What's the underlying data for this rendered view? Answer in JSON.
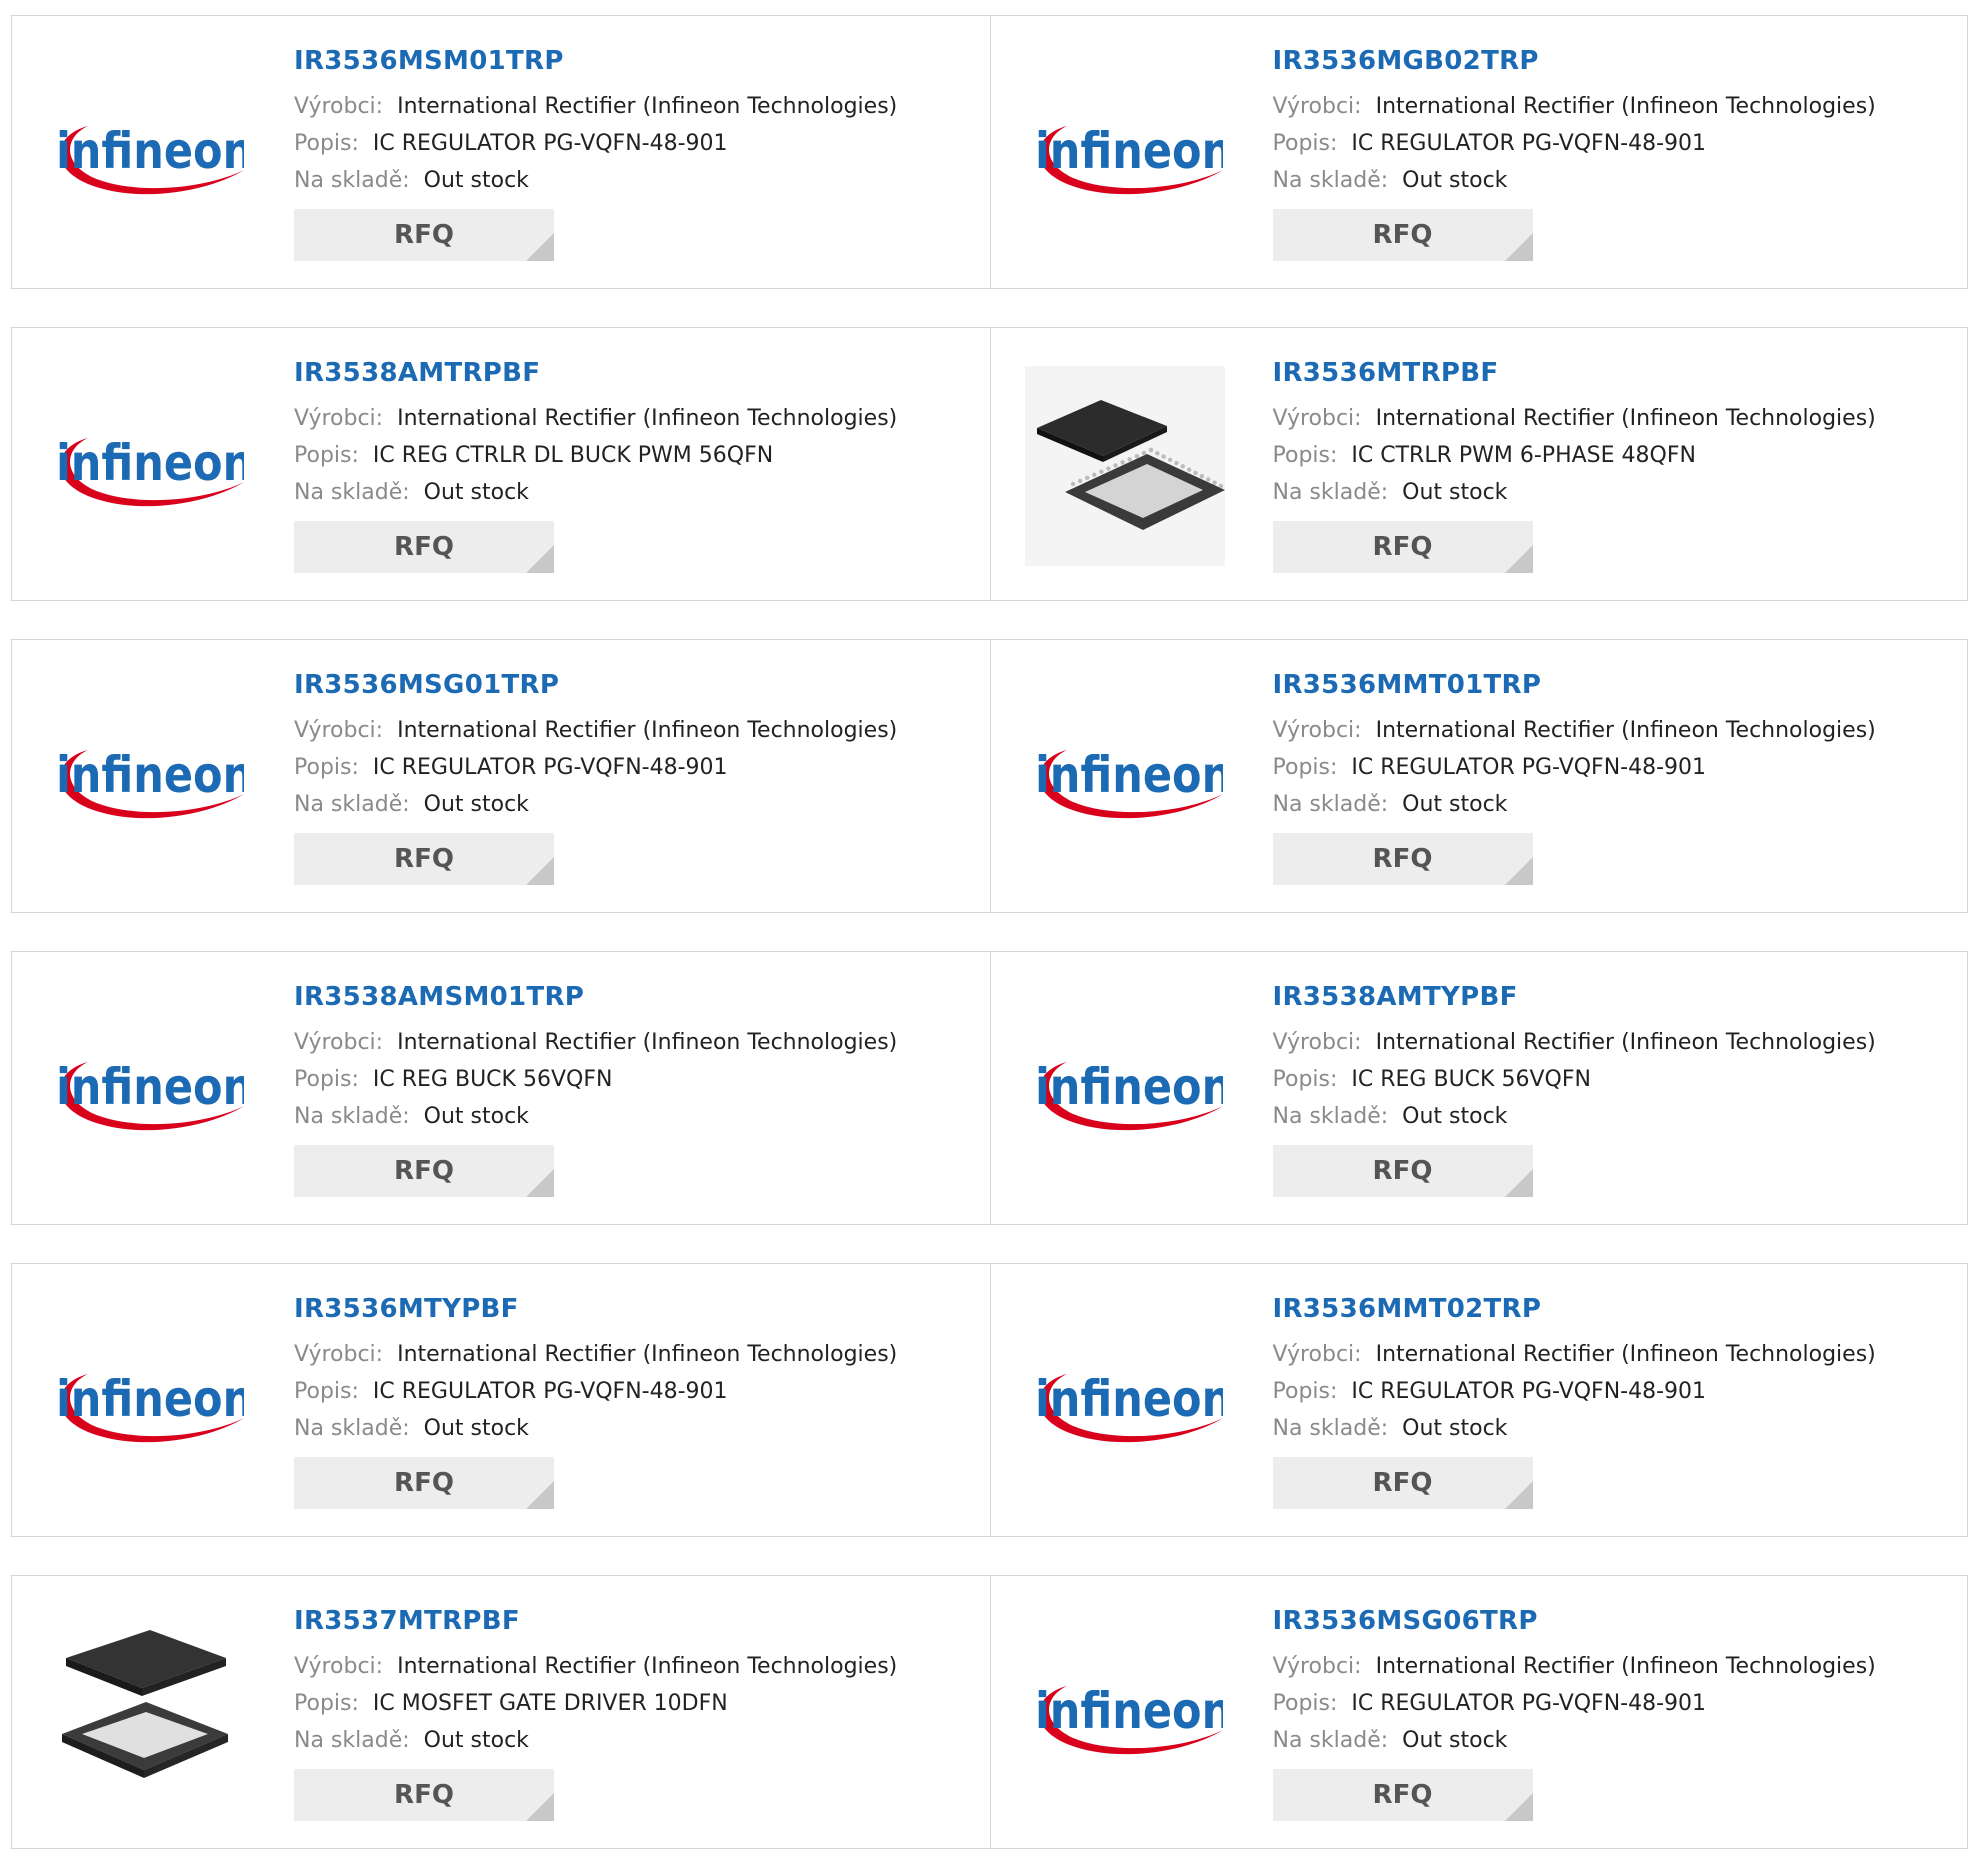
{
  "labels": {
    "manufacturer": "Výrobci:",
    "description": "Popis:",
    "stock": "Na skladě:",
    "rfq": "RFQ"
  },
  "brand": {
    "logo_text": "infineon",
    "accent": "#d9001b",
    "text_color": "#1b6ab3"
  },
  "products": [
    {
      "part": "IR3536MSM01TRP",
      "manufacturer": "International Rectifier (Infineon Technologies)",
      "description": "IC REGULATOR PG-VQFN-48-901",
      "stock": "Out stock",
      "image": "infineon-logo"
    },
    {
      "part": "IR3536MGB02TRP",
      "manufacturer": "International Rectifier (Infineon Technologies)",
      "description": "IC REGULATOR PG-VQFN-48-901",
      "stock": "Out stock",
      "image": "infineon-logo"
    },
    {
      "part": "IR3538AMTRPBF",
      "manufacturer": "International Rectifier (Infineon Technologies)",
      "description": "IC REG CTRLR DL BUCK PWM 56QFN",
      "stock": "Out stock",
      "image": "infineon-logo"
    },
    {
      "part": "IR3536MTRPBF",
      "manufacturer": "International Rectifier (Infineon Technologies)",
      "description": "IC CTRLR PWM 6-PHASE 48QFN",
      "stock": "Out stock",
      "image": "qfn-chip-photo"
    },
    {
      "part": "IR3536MSG01TRP",
      "manufacturer": "International Rectifier (Infineon Technologies)",
      "description": "IC REGULATOR PG-VQFN-48-901",
      "stock": "Out stock",
      "image": "infineon-logo"
    },
    {
      "part": "IR3536MMT01TRP",
      "manufacturer": "International Rectifier (Infineon Technologies)",
      "description": "IC REGULATOR PG-VQFN-48-901",
      "stock": "Out stock",
      "image": "infineon-logo"
    },
    {
      "part": "IR3538AMSM01TRP",
      "manufacturer": "International Rectifier (Infineon Technologies)",
      "description": "IC REG BUCK 56VQFN",
      "stock": "Out stock",
      "image": "infineon-logo"
    },
    {
      "part": "IR3538AMTYPBF",
      "manufacturer": "International Rectifier (Infineon Technologies)",
      "description": "IC REG BUCK 56VQFN",
      "stock": "Out stock",
      "image": "infineon-logo"
    },
    {
      "part": "IR3536MTYPBF",
      "manufacturer": "International Rectifier (Infineon Technologies)",
      "description": "IC REGULATOR PG-VQFN-48-901",
      "stock": "Out stock",
      "image": "infineon-logo"
    },
    {
      "part": "IR3536MMT02TRP",
      "manufacturer": "International Rectifier (Infineon Technologies)",
      "description": "IC REGULATOR PG-VQFN-48-901",
      "stock": "Out stock",
      "image": "infineon-logo"
    },
    {
      "part": "IR3537MTRPBF",
      "manufacturer": "International Rectifier (Infineon Technologies)",
      "description": "IC MOSFET GATE DRIVER 10DFN",
      "stock": "Out stock",
      "image": "dfn-chip-photo"
    },
    {
      "part": "IR3536MSG06TRP",
      "manufacturer": "International Rectifier (Infineon Technologies)",
      "description": "IC REGULATOR PG-VQFN-48-901",
      "stock": "Out stock",
      "image": "infineon-logo"
    }
  ]
}
